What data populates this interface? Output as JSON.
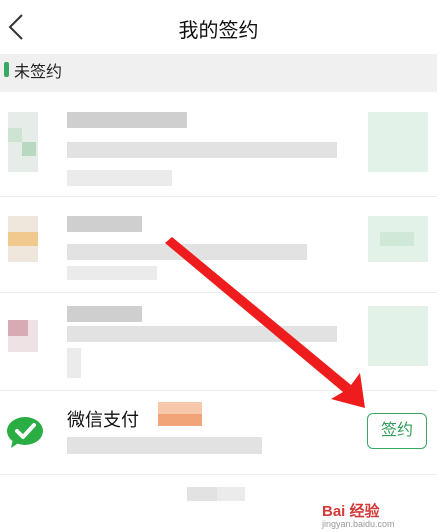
{
  "header": {
    "title": "我的签约",
    "back_icon": "chevron-left-icon"
  },
  "section": {
    "label": "未签约",
    "accent_color": "#3aa863"
  },
  "contracts": [
    {
      "name": "",
      "obscured": true
    },
    {
      "name": "",
      "obscured": true
    },
    {
      "name": "",
      "obscured": true
    },
    {
      "name": "微信支付",
      "logo_icon": "wechat-pay-icon",
      "action_label": "签约"
    }
  ],
  "annotation": {
    "type": "red-arrow",
    "color": "#ee1c1c"
  },
  "watermark": {
    "text": "Bai 经验",
    "sub": "jingyan.baidu.com"
  }
}
